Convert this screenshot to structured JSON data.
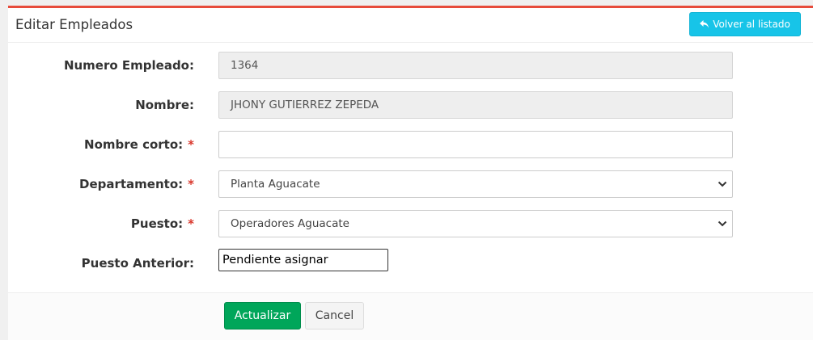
{
  "panel": {
    "title": "Editar Empleados",
    "back_button_label": "Volver al listado",
    "accent_color": "#e74c3c",
    "back_button_color": "#17c4e8",
    "back_icon": "reply-arrow-icon"
  },
  "form": {
    "numero_empleado": {
      "label": "Numero Empleado:",
      "value": "1364"
    },
    "nombre": {
      "label": "Nombre:",
      "value": "JHONY GUTIERREZ ZEPEDA"
    },
    "nombre_corto": {
      "label": "Nombre corto:",
      "required_mark": "*",
      "value": ""
    },
    "departamento": {
      "label": "Departamento:",
      "required_mark": "*",
      "selected": "Planta Aguacate"
    },
    "puesto": {
      "label": "Puesto:",
      "required_mark": "*",
      "selected": "Operadores Aguacate"
    },
    "puesto_anterior": {
      "label": "Puesto Anterior:",
      "value": "Pendiente asignar"
    }
  },
  "footer": {
    "update_label": "Actualizar",
    "cancel_label": "Cancel",
    "update_color": "#00a65a"
  }
}
